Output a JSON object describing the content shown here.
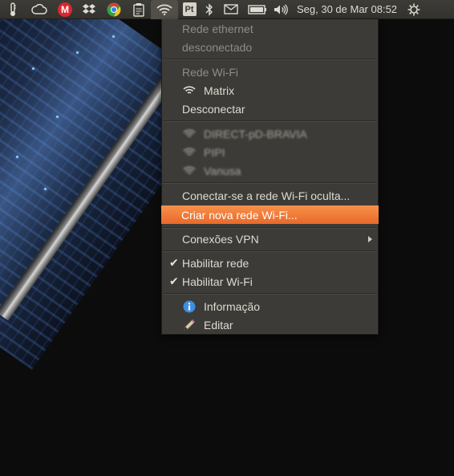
{
  "panel": {
    "indicators": [
      "thermometer-icon",
      "cloud-icon",
      "mega-icon",
      "dropbox-icon",
      "chrome-icon",
      "clipboard-icon",
      "wifi-icon",
      "keyboard-layout",
      "bluetooth-icon",
      "mail-icon",
      "battery-icon",
      "volume-icon"
    ],
    "keyboard_layout": "Pt",
    "clock": "Seg, 30 de Mar 08:52",
    "mega_label": "M"
  },
  "menu": {
    "ethernet_header": "Rede ethernet",
    "ethernet_status": "desconectado",
    "wifi_header": "Rede Wi-Fi",
    "connected_network": "Matrix",
    "disconnect": "Desconectar",
    "networks": [
      "DIRECT-pD-BRAVIA",
      "PIPI",
      "Vanusa"
    ],
    "connect_hidden": "Conectar-se a rede Wi-Fi oculta...",
    "create_new": "Criar nova rede Wi-Fi...",
    "vpn": "Conexões VPN",
    "enable_network": "Habilitar rede",
    "enable_wifi": "Habilitar Wi-Fi",
    "info": "Informação",
    "edit": "Editar"
  },
  "colors": {
    "panel_bg": "#3c3b37",
    "menu_bg": "#3c3b37",
    "highlight": "#f07746",
    "text": "#dfdbd2",
    "disabled_text": "#8f8c84"
  }
}
